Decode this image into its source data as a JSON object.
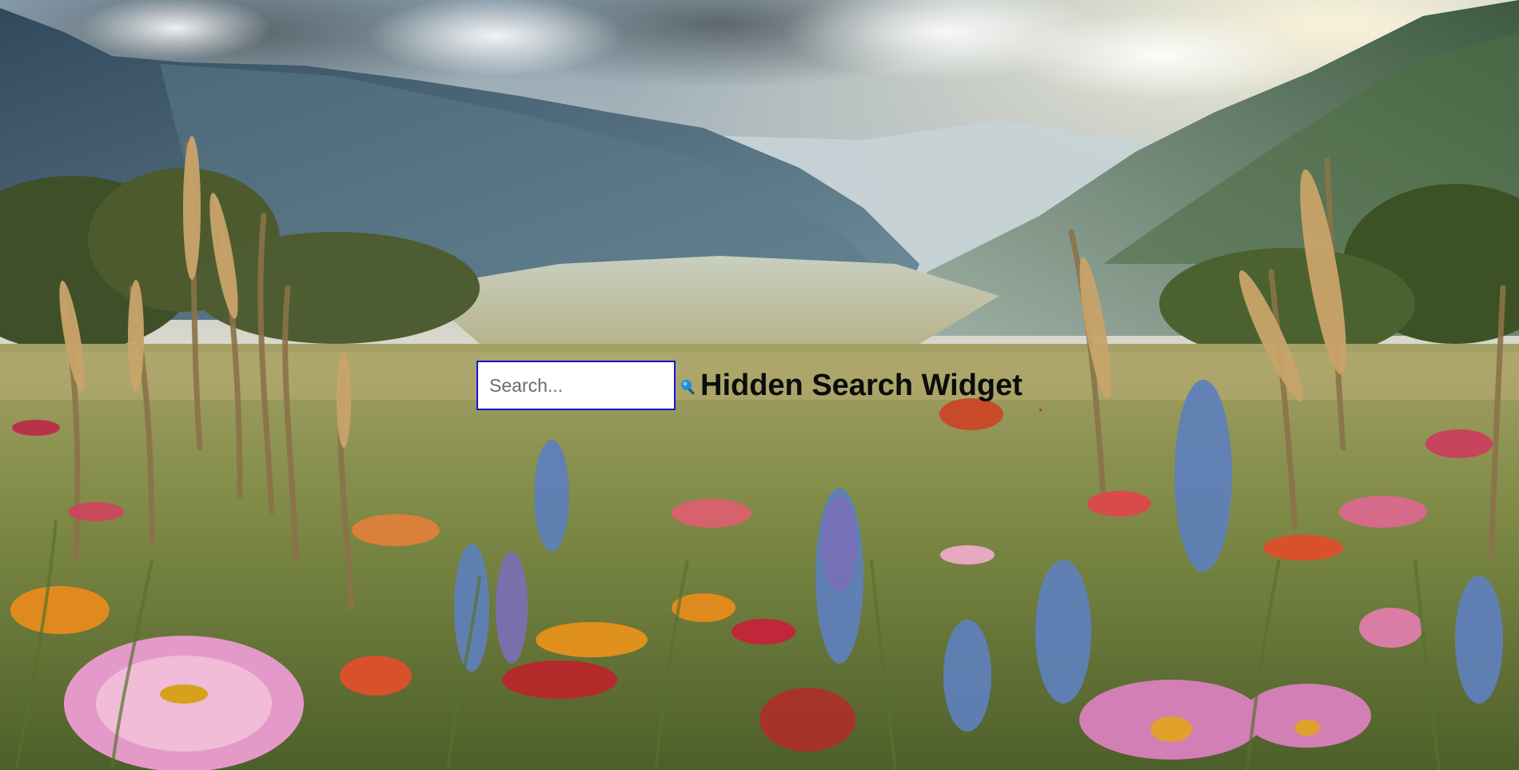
{
  "page": {
    "background_scene": "mountain-valley-wildflower-meadow"
  },
  "search": {
    "placeholder": "Search...",
    "value": "",
    "button_icon": "magnifier-search-icon",
    "input_border_color": "#1414d6",
    "icon_color": "#1e8fe0"
  },
  "widget": {
    "title": "Hidden Search Widget"
  }
}
